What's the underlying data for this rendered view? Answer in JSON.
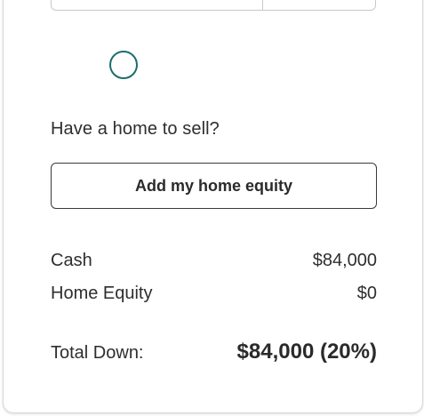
{
  "home_sale": {
    "question": "Have a home to sell?",
    "button_label": "Add my home equity"
  },
  "summary": {
    "cash_label": "Cash",
    "cash_value": "$84,000",
    "equity_label": "Home Equity",
    "equity_value": "$0",
    "total_label": "Total Down:",
    "total_value": "$84,000 (20%)"
  },
  "colors": {
    "radio_border": "#1d6c6c",
    "text": "#2e2e2e"
  }
}
